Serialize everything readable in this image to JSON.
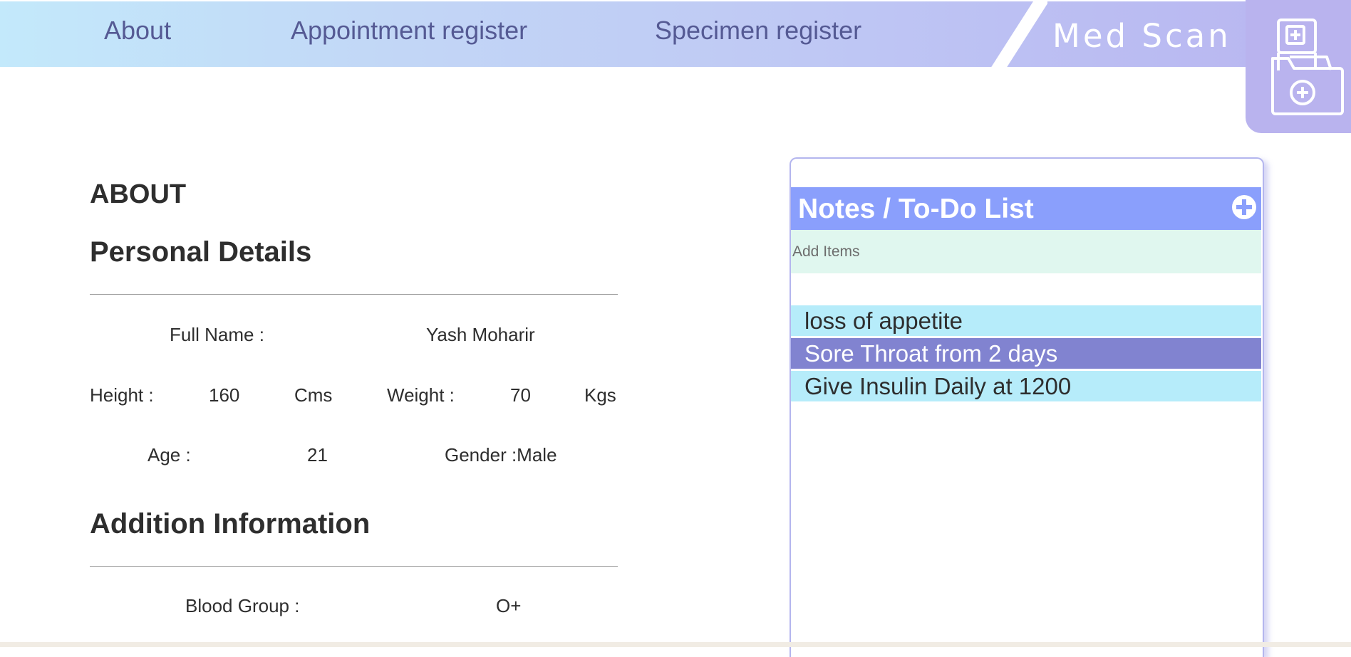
{
  "nav": {
    "links": [
      "About",
      "Appointment register",
      "Specimen register"
    ],
    "brand": "Med Scan",
    "logo_icon": "medical-folder-icon"
  },
  "about": {
    "heading": "ABOUT",
    "personal": {
      "heading": "Personal Details",
      "full_name_label": "Full Name :",
      "full_name": "Yash Moharir",
      "height_label": "Height :",
      "height": "160",
      "height_unit": "Cms",
      "weight_label": "Weight :",
      "weight": "70",
      "weight_unit": "Kgs",
      "age_label": "Age :",
      "age": "21",
      "gender": "Gender :Male"
    },
    "additional": {
      "heading": "Addition Information",
      "blood_group_label": "Blood Group :",
      "blood_group": "O+"
    }
  },
  "notes": {
    "title": "Notes / To-Do List",
    "add_icon": "plus-circle-icon",
    "input_placeholder": "Add Items",
    "items": [
      "loss of appetite",
      "Sore Throat from 2 days",
      "Give Insulin Daily at 1200"
    ],
    "selected_index": 1
  },
  "colors": {
    "nav_text": "#555a94",
    "header_accent": "#8a9ffc",
    "selected_item": "#8183d0",
    "item_bg": "#b6ecfa",
    "input_bg": "#e0f7ef"
  }
}
